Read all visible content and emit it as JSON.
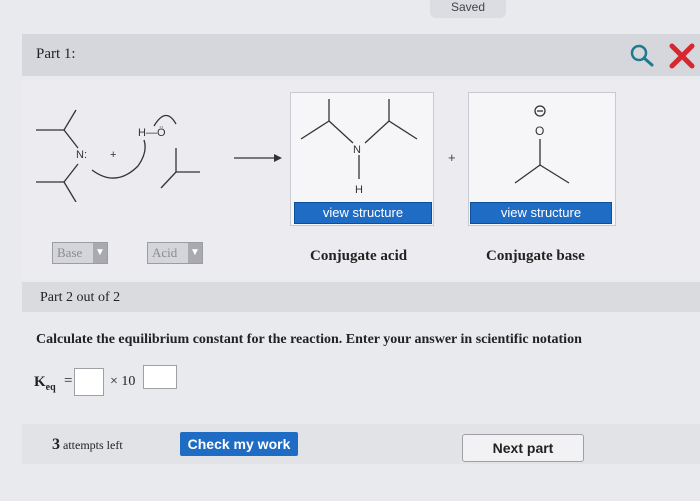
{
  "header": {
    "saved_label": "Saved"
  },
  "part1": {
    "title": "Part 1:",
    "reactant_labels": {
      "n_label": "N:",
      "h_o_label": "H—Ö",
      "plus": "+"
    },
    "product_acid": {
      "n_label": "N",
      "h_label": "H",
      "view_label": "view structure"
    },
    "product_base": {
      "o_label": "O",
      "view_label": "view structure"
    },
    "plus_label": "+",
    "dropdowns": {
      "base_label": "Base",
      "acid_label": "Acid"
    },
    "conjugate_acid_label": "Conjugate acid",
    "conjugate_base_label": "Conjugate base"
  },
  "part2": {
    "title": "Part 2 out of 2",
    "question": "Calculate the equilibrium constant for the reaction. Enter your answer in scientific notation",
    "keq_main": "K",
    "keq_sub": "eq",
    "equals": "=",
    "times_ten": "× 10",
    "mantissa_value": "",
    "exponent_value": ""
  },
  "footer": {
    "attempts_count": "3",
    "attempts_text": "attempts left",
    "check_label": "Check my work",
    "next_label": "Next part"
  },
  "colors": {
    "button_blue": "#1f6cc4",
    "close_red": "#d9272e",
    "search_teal": "#1e7a8c"
  }
}
